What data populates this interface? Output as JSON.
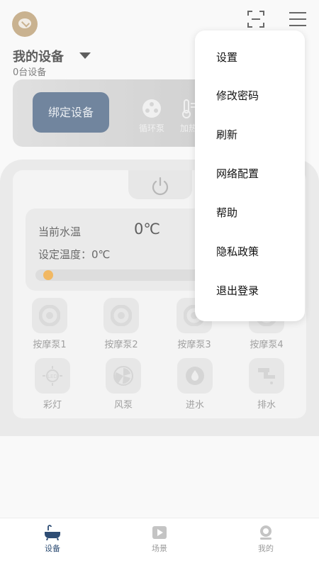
{
  "header": {
    "title": "我的设备",
    "device_count": "0台设备"
  },
  "banner": {
    "bind_label": "绑定设备",
    "feature_pump": "循环泵",
    "feature_heat": "加热"
  },
  "device": {
    "current_temp_label": "当前水温",
    "current_temp_value": "0℃",
    "set_temp_label": "设定温度：",
    "set_temp_value": "0℃",
    "controls": [
      "按摩泵1",
      "按摩泵2",
      "按摩泵3",
      "按摩泵4",
      "彩灯",
      "风泵",
      "进水",
      "排水"
    ]
  },
  "menu": {
    "items": [
      "设置",
      "修改密码",
      "刷新",
      "网络配置",
      "帮助",
      "隐私政策",
      "退出登录"
    ]
  },
  "bottom_nav": {
    "items": [
      "设备",
      "场景",
      "我的"
    ]
  },
  "colors": {
    "primary": "#2e4d74",
    "accent": "#f39c1a",
    "brand": "#b6935f"
  },
  "icons": [
    "logo-icon",
    "scan-icon",
    "menu-icon",
    "power-icon",
    "massage-pump-icon",
    "led-icon",
    "air-pump-icon",
    "water-in-icon",
    "drain-icon",
    "bathtub-icon",
    "play-icon",
    "profile-icon"
  ]
}
